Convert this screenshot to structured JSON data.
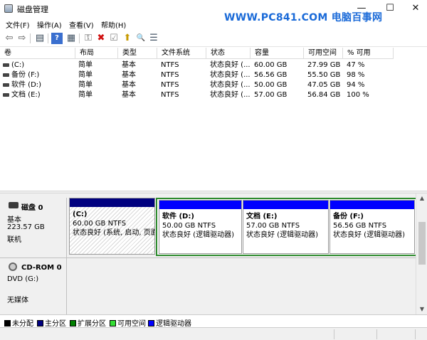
{
  "window": {
    "title": "磁盘管理",
    "watermark": "WWW.PC841.COM 电脑百事网",
    "minimize": "—",
    "maximize": "☐",
    "close": "✕"
  },
  "menu": [
    "文件(F)",
    "操作(A)",
    "查看(V)",
    "帮助(H)"
  ],
  "toolbar": {
    "back": "⇦",
    "forward": "⇨",
    "console": "▤",
    "help": "?",
    "props": "▦",
    "connect": "⚿",
    "delete": "✖",
    "check": "☑",
    "up": "⬆",
    "find": "🔍",
    "list": "☰"
  },
  "volumes": {
    "headers": [
      "卷",
      "布局",
      "类型",
      "文件系统",
      "状态",
      "容量",
      "可用空间",
      "% 可用"
    ],
    "rows": [
      [
        "(C:)",
        "简单",
        "基本",
        "NTFS",
        "状态良好 (...",
        "60.00 GB",
        "27.99 GB",
        "47 %"
      ],
      [
        "备份 (F:)",
        "简单",
        "基本",
        "NTFS",
        "状态良好 (...",
        "56.56 GB",
        "55.50 GB",
        "98 %"
      ],
      [
        "软件 (D:)",
        "简单",
        "基本",
        "NTFS",
        "状态良好 (...",
        "50.00 GB",
        "47.05 GB",
        "94 %"
      ],
      [
        "文档 (E:)",
        "简单",
        "基本",
        "NTFS",
        "状态良好 (...",
        "57.00 GB",
        "56.84 GB",
        "100 %"
      ]
    ]
  },
  "disk0": {
    "name": "磁盘 0",
    "type": "基本",
    "size": "223.57 GB",
    "status": "联机",
    "partitions": [
      {
        "name": "(C:)",
        "size": "60.00 GB NTFS",
        "status": "状态良好 (系统, 启动, 页面",
        "bar_color": "#00007f"
      },
      {
        "name": "软件 (D:)",
        "size": "50.00 GB NTFS",
        "status": "状态良好 (逻辑驱动器)",
        "bar_color": "#0000ff"
      },
      {
        "name": "文档 (E:)",
        "size": "57.00 GB NTFS",
        "status": "状态良好 (逻辑驱动器)",
        "bar_color": "#0000ff"
      },
      {
        "name": "备份 (F:)",
        "size": "56.56 GB NTFS",
        "status": "状态良好 (逻辑驱动器)",
        "bar_color": "#0000ff"
      }
    ]
  },
  "cdrom": {
    "name": "CD-ROM 0",
    "type": "DVD (G:)",
    "status": "无媒体"
  },
  "legend": [
    {
      "label": "未分配",
      "color": "#000000"
    },
    {
      "label": "主分区",
      "color": "#00007f"
    },
    {
      "label": "扩展分区",
      "color": "#007f00"
    },
    {
      "label": "可用空间",
      "color": "#33dd33"
    },
    {
      "label": "逻辑驱动器",
      "color": "#0000ff"
    }
  ]
}
